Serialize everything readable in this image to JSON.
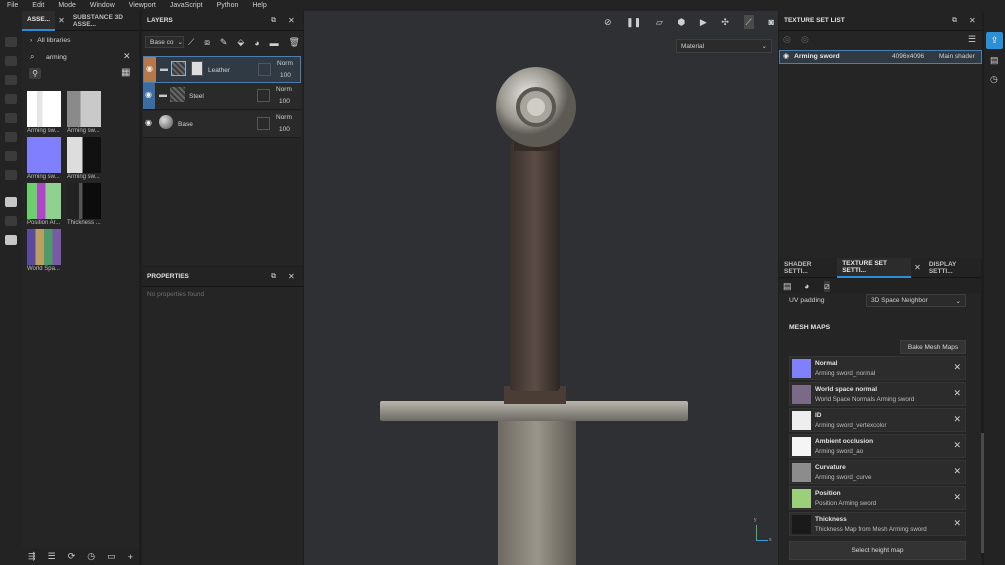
{
  "menu": [
    "File",
    "Edit",
    "Mode",
    "Window",
    "Viewport",
    "JavaScript",
    "Python",
    "Help"
  ],
  "assets_panel": {
    "tabs": [
      "ASSE...",
      "SUBSTANCE 3D ASSE..."
    ],
    "breadcrumb": "All libraries",
    "search_value": "arming",
    "thumbnails": [
      {
        "caption": "Arming sw...",
        "color": "#f2f2f2"
      },
      {
        "caption": "Arming sw...",
        "color": "#bdbdbd"
      },
      {
        "caption": "Arming sw...",
        "color": "#8080ff"
      },
      {
        "caption": "Arming sw...",
        "color": "#222222"
      },
      {
        "caption": "Position Ar...",
        "color": "#8fd18f"
      },
      {
        "caption": "Thickness ...",
        "color": "#151515"
      },
      {
        "caption": "World Spa...",
        "color": "#6a5aa0"
      }
    ]
  },
  "layers_panel": {
    "title": "LAYERS",
    "channel": "Base co",
    "layers": [
      {
        "name": "Leather",
        "blend": "Norm",
        "opacity": "100",
        "color": "#b5784a"
      },
      {
        "name": "Steel",
        "blend": "Norm",
        "opacity": "100",
        "color": "#3b6da3"
      },
      {
        "name": "Base",
        "blend": "Norm",
        "opacity": "100",
        "color": ""
      }
    ]
  },
  "properties_panel": {
    "title": "PROPERTIES",
    "empty_text": "No properties found"
  },
  "viewport": {
    "material_mode": "Material",
    "axis_x": "x",
    "axis_y": "y"
  },
  "texture_set_list": {
    "title": "TEXTURE SET LIST",
    "row": {
      "name": "Arming sword",
      "resolution": "4096x4096",
      "shader": "Main shader"
    }
  },
  "settings_panel": {
    "tabs": [
      "SHADER SETTI...",
      "TEXTURE SET SETTI...",
      "DISPLAY SETTI..."
    ],
    "uv_padding_label": "UV padding",
    "uv_padding_value": "3D Space Neighbor",
    "mesh_maps_title": "MESH MAPS",
    "bake_button": "Bake Mesh Maps",
    "mesh_maps": [
      {
        "title": "Normal",
        "sub": "Arming sword_normal",
        "color": "#8080ff"
      },
      {
        "title": "World space normal",
        "sub": "World Space Normals Arming sword",
        "color": "#7a6a88"
      },
      {
        "title": "ID",
        "sub": "Arming sword_vertexcolor",
        "color": "#eeeeee"
      },
      {
        "title": "Ambient occlusion",
        "sub": "Arming sword_ao",
        "color": "#f5f5f5"
      },
      {
        "title": "Curvature",
        "sub": "Arming sword_curve",
        "color": "#8c8c8c"
      },
      {
        "title": "Position",
        "sub": "Position Arming sword",
        "color": "#9ccf7a"
      },
      {
        "title": "Thickness",
        "sub": "Thickness Map from Mesh Arming sword",
        "color": "#1a1a1a"
      }
    ],
    "height_button": "Select height map"
  },
  "colors": {
    "accent": "#2b8fd8",
    "panel": "#252525",
    "viewport": "#2e3033"
  }
}
